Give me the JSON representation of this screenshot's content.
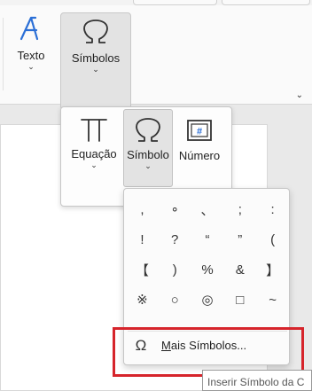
{
  "ribbon": {
    "texto": {
      "label": "Texto",
      "icon": "text-icon"
    },
    "simbolos": {
      "label": "Símbolos",
      "icon": "omega-icon"
    },
    "expand_icon": "chevron-down-icon"
  },
  "flyout": {
    "equacao": {
      "label": "Equação",
      "icon": "pi-icon"
    },
    "simbolo": {
      "label": "Símbolo",
      "icon": "omega-icon"
    },
    "numero": {
      "label": "Número",
      "icon": "number-icon",
      "glyph": "#"
    }
  },
  "gallery": {
    "symbols": [
      [
        ",",
        "∘",
        "、",
        ";",
        ":"
      ],
      [
        "!",
        "?",
        "“",
        "”",
        "("
      ],
      [
        "【",
        ")",
        "%",
        "&",
        "】"
      ],
      [
        "※",
        "○",
        "◎",
        "□",
        "~"
      ]
    ],
    "more_symbols": {
      "accel": "M",
      "rest": "ais Símbolos...",
      "icon": "omega-icon"
    }
  },
  "tooltip": {
    "text": "Inserir Símbolo da C"
  },
  "colors": {
    "accent_blue": "#2b6fd6",
    "highlight_red": "#d6242b"
  }
}
